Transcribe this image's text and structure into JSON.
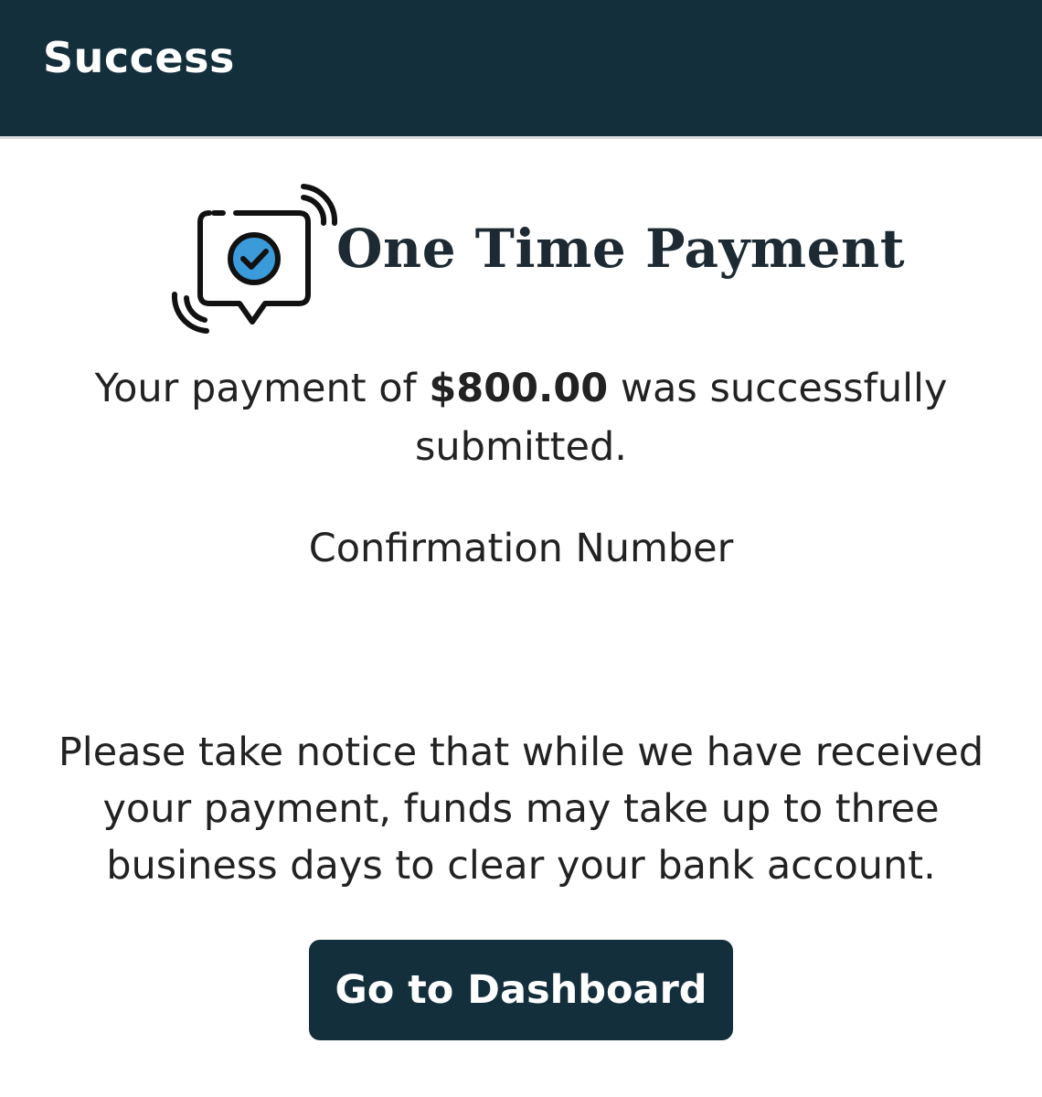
{
  "header": {
    "title": "Success"
  },
  "logo": {
    "title": "One Time Payment",
    "icon": "check-message-icon",
    "accent_color": "#3b9ad9"
  },
  "message": {
    "prefix": "Your payment of ",
    "amount": "$800.00",
    "suffix": " was successfully submitted."
  },
  "confirmation": {
    "label": "Confirmation Number"
  },
  "notice": {
    "text": "Please take notice that while we have received your payment, funds may take up to three business days to clear your bank account."
  },
  "actions": {
    "dashboard_label": "Go to Dashboard"
  },
  "colors": {
    "header_bg": "#142f3c",
    "button_bg": "#142f3c",
    "text": "#222222"
  }
}
